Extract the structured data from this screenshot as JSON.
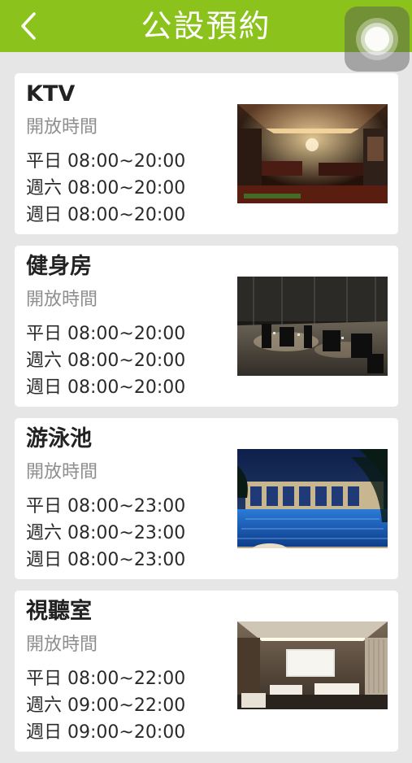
{
  "header": {
    "title": "公設預約",
    "back_icon": "chevron-left-icon",
    "color": "#8bc21c"
  },
  "facilities": [
    {
      "name": "KTV",
      "hours_label": "開放時間",
      "weekday": "平日 08:00~20:00",
      "saturday": "週六 08:00~20:00",
      "sunday": "週日 08:00~20:00",
      "photo": "ktv-room-photo"
    },
    {
      "name": "健身房",
      "hours_label": "開放時間",
      "weekday": "平日 08:00~20:00",
      "saturday": "週六 08:00~20:00",
      "sunday": "週日 08:00~20:00",
      "photo": "gym-photo"
    },
    {
      "name": "游泳池",
      "hours_label": "開放時間",
      "weekday": "平日 08:00~23:00",
      "saturday": "週六 08:00~23:00",
      "sunday": "週日 08:00~23:00",
      "photo": "pool-photo"
    },
    {
      "name": "視聽室",
      "hours_label": "開放時間",
      "weekday": "平日 08:00~22:00",
      "saturday": "週六 09:00~22:00",
      "sunday": "週日 09:00~20:00",
      "photo": "theater-photo"
    }
  ]
}
